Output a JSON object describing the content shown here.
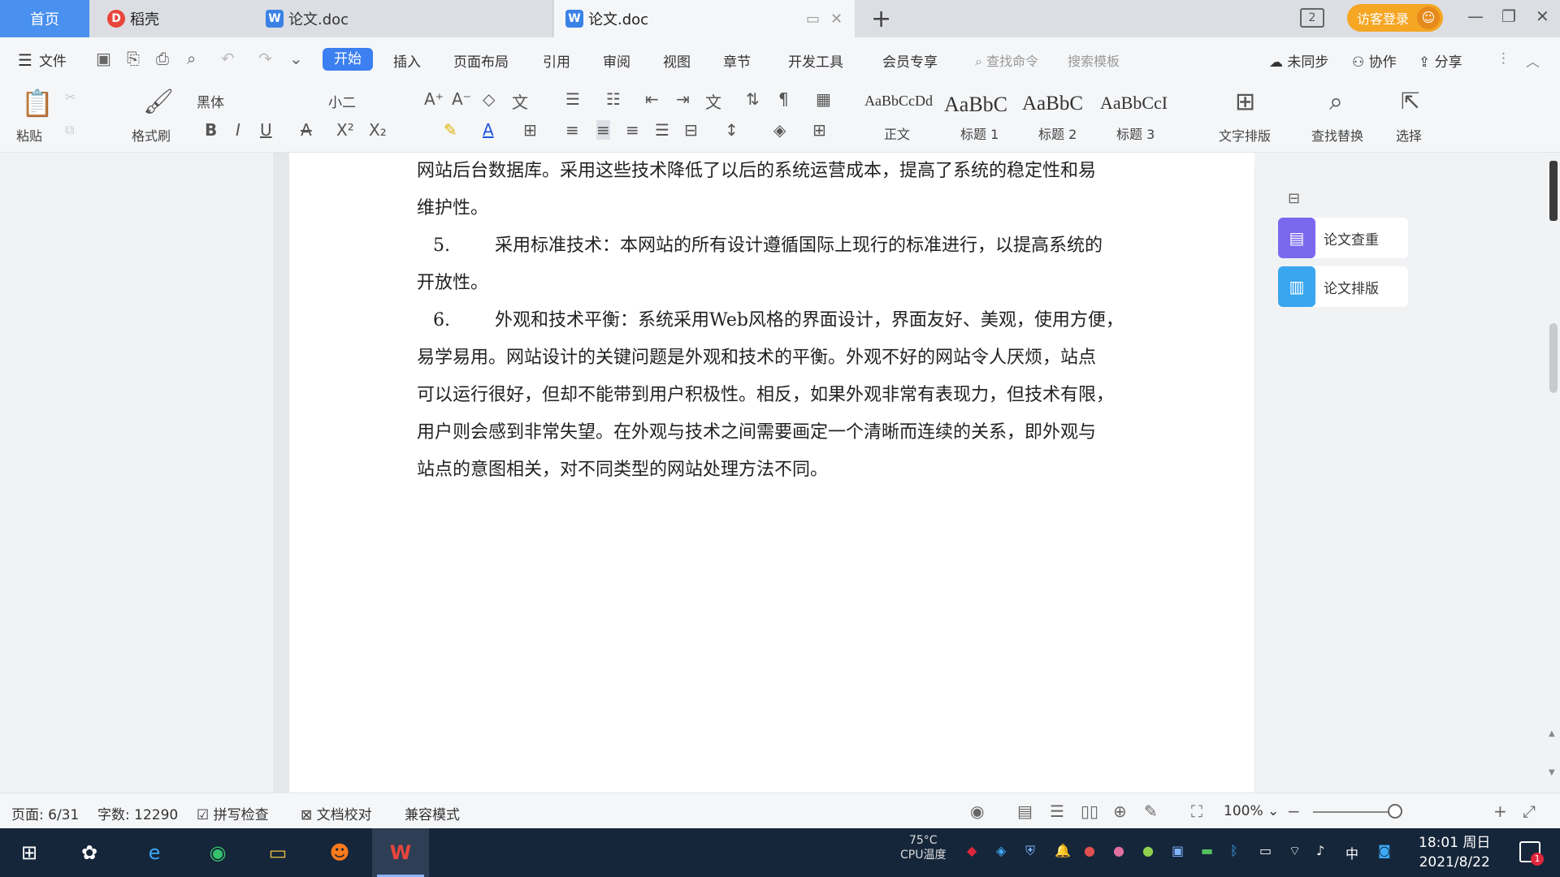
{
  "tabs": {
    "home": "首页",
    "daoke": "稻壳",
    "doc1": "论文.doc",
    "doc2": "论文.doc"
  },
  "titlebar": {
    "window_badge": "2",
    "visitor_label": "访客登录"
  },
  "menu": {
    "file": "文件",
    "items": [
      "开始",
      "插入",
      "页面布局",
      "引用",
      "审阅",
      "视图",
      "章节",
      "开发工具",
      "会员专享"
    ],
    "search_placeholder": "查找命令",
    "search_template": "搜索模板",
    "sync": "未同步",
    "collab": "协作",
    "share": "分享"
  },
  "ribbon": {
    "paste": "粘贴",
    "format_painter": "格式刷",
    "font_name": "黑体",
    "font_size": "小二",
    "styles": [
      {
        "sample": "AaBbCcDd",
        "name": "正文"
      },
      {
        "sample": "AaBbC",
        "name": "标题 1"
      },
      {
        "sample": "AaBbC",
        "name": "标题 2"
      },
      {
        "sample": "AaBbCcI",
        "name": "标题 3"
      }
    ],
    "text_layout": "文字排版",
    "find_replace": "查找替换",
    "select": "选择"
  },
  "document": {
    "para0": [
      "网站后台数据库。采用这些技术降低了以后的系统运营成本，提高了系统的稳定性和易",
      "维护性。"
    ],
    "item5_num": "5.",
    "item5": [
      "采用标准技术：本网站的所有设计遵循国际上现行的标准进行，以提高系统的",
      "开放性。"
    ],
    "item6_num": "6.",
    "item6": [
      "外观和技术平衡：系统采用Web风格的界面设计，界面友好、美观，使用方便，",
      "易学易用。网站设计的关键问题是外观和技术的平衡。外观不好的网站令人厌烦，站点",
      "可以运行很好，但却不能带到用户积极性。相反，如果外观非常有表现力，但技术有限，",
      "用户则会感到非常失望。在外观与技术之间需要画定一个清晰而连续的关系，即外观与",
      "站点的意图相关，对不同类型的网站处理方法不同。"
    ]
  },
  "sidepanel": {
    "check": "论文查重",
    "format": "论文排版"
  },
  "status": {
    "page": "页面: 6/31",
    "words": "字数: 12290",
    "spell": "拼写检查",
    "proof": "文档校对",
    "compat": "兼容模式",
    "zoom": "100%"
  },
  "taskbar": {
    "cpu_temp": "75°C",
    "cpu_label": "CPU温度",
    "ime": "中",
    "time": "18:01 周日",
    "date": "2021/8/22",
    "notif_count": "1"
  }
}
